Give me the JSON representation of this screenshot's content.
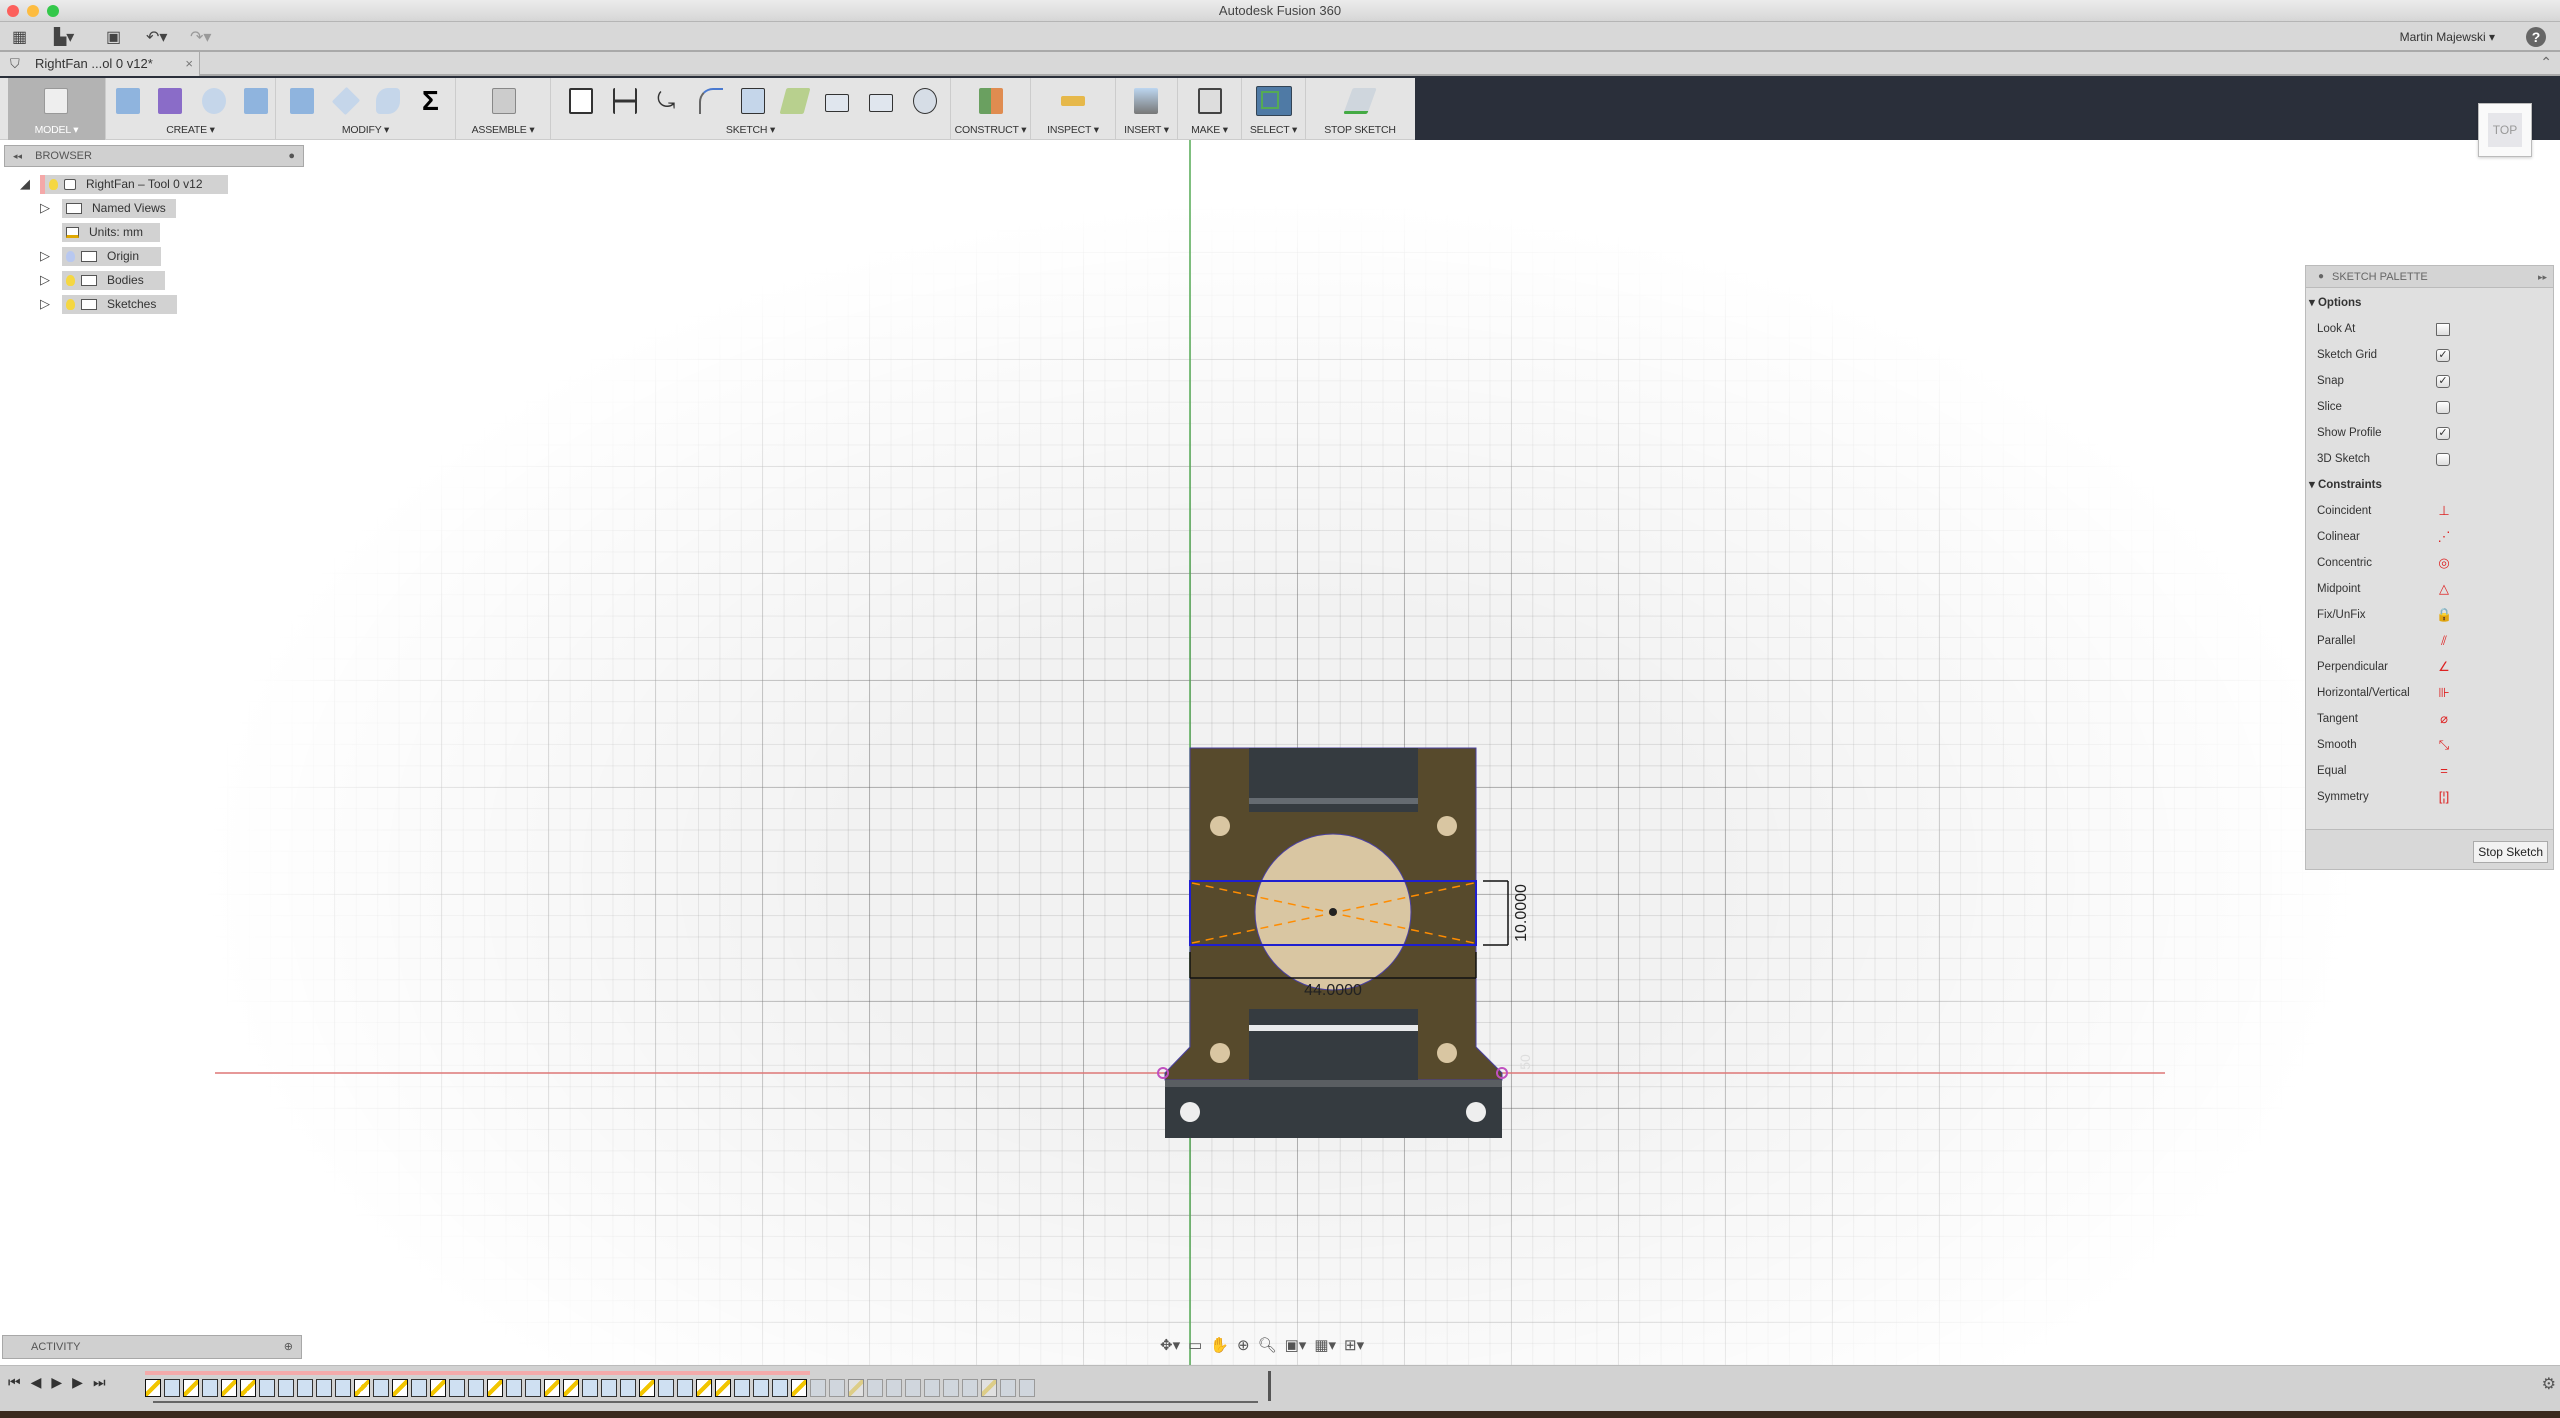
{
  "window": {
    "title": "Autodesk Fusion 360",
    "user": "Martin Majewski",
    "help_label": "?"
  },
  "quick_access": [
    {
      "name": "data-panel",
      "icon": "grid-icon"
    },
    {
      "name": "file",
      "icon": "file-icon"
    },
    {
      "name": "save",
      "icon": "save-icon"
    },
    {
      "name": "undo",
      "icon": "undo-icon"
    },
    {
      "name": "redo",
      "icon": "redo-icon"
    }
  ],
  "document_tab": {
    "label": "RightFan ...ol 0 v12*",
    "close": "×"
  },
  "ribbon": {
    "groups": [
      {
        "label": "MODEL ▾",
        "tools": [
          "model-workspace"
        ]
      },
      {
        "label": "CREATE ▾",
        "tools": [
          "box",
          "coil",
          "hole",
          "extrude"
        ]
      },
      {
        "label": "MODIFY ▾",
        "tools": [
          "press-pull",
          "fillet",
          "chamfer",
          "parameters"
        ]
      },
      {
        "label": "ASSEMBLE ▾",
        "tools": [
          "joint"
        ]
      },
      {
        "label": "SKETCH ▾",
        "tools": [
          "create-sketch",
          "dimension",
          "trim",
          "fillet-sketch",
          "offset",
          "project",
          "rectangle",
          "center-rectangle",
          "polygon"
        ]
      },
      {
        "label": "CONSTRUCT ▾",
        "tools": [
          "offset-plane"
        ]
      },
      {
        "label": "INSPECT ▾",
        "tools": [
          "measure"
        ]
      },
      {
        "label": "INSERT ▾",
        "tools": [
          "canvas"
        ]
      },
      {
        "label": "MAKE ▾",
        "tools": [
          "3d-print"
        ]
      },
      {
        "label": "SELECT ▾",
        "tools": [
          "select"
        ]
      },
      {
        "label": "STOP SKETCH",
        "tools": [
          "stop-sketch"
        ]
      }
    ]
  },
  "browser": {
    "title": "BROWSER",
    "items": [
      {
        "label": "RightFan – Tool 0 v12",
        "bulb": "on"
      },
      {
        "label": "Named Views"
      },
      {
        "label": "Units: mm"
      },
      {
        "label": "Origin",
        "bulb": "off"
      },
      {
        "label": "Bodies",
        "bulb": "on"
      },
      {
        "label": "Sketches",
        "bulb": "on"
      }
    ]
  },
  "activity": {
    "title": "ACTIVITY"
  },
  "viewcube": {
    "face": "TOP"
  },
  "sketch": {
    "dim_width": "44.0000",
    "dim_height": "10.0000",
    "grid_label": "50"
  },
  "sketch_palette": {
    "title": "SKETCH PALETTE",
    "options_label": "Options",
    "options": [
      {
        "label": "Look At",
        "type": "button"
      },
      {
        "label": "Sketch Grid",
        "checked": true
      },
      {
        "label": "Snap",
        "checked": true
      },
      {
        "label": "Slice",
        "checked": false
      },
      {
        "label": "Show Profile",
        "checked": true
      },
      {
        "label": "3D Sketch",
        "checked": false
      }
    ],
    "constraints_label": "Constraints",
    "constraints": [
      {
        "label": "Coincident",
        "glyph": "⊥"
      },
      {
        "label": "Colinear",
        "glyph": "⋰"
      },
      {
        "label": "Concentric",
        "glyph": "◎"
      },
      {
        "label": "Midpoint",
        "glyph": "△"
      },
      {
        "label": "Fix/UnFix",
        "glyph": "🔒"
      },
      {
        "label": "Parallel",
        "glyph": "⫽"
      },
      {
        "label": "Perpendicular",
        "glyph": "∠"
      },
      {
        "label": "Horizontal/Vertical",
        "glyph": "⊪"
      },
      {
        "label": "Tangent",
        "glyph": "⌀"
      },
      {
        "label": "Smooth",
        "glyph": "⤡"
      },
      {
        "label": "Equal",
        "glyph": "="
      },
      {
        "label": "Symmetry",
        "glyph": "[¦]"
      }
    ],
    "stop_label": "Stop Sketch"
  },
  "colors": {
    "plate": "#574a2c",
    "profile": "#d9c6a2",
    "slot": "#353b40",
    "selection": "#1f1fd0",
    "construction": "#ff8c00",
    "x_axis": "#c84848",
    "y_axis": "#3a9a3a"
  },
  "timeline": {
    "active": [
      "sketch",
      "extrude",
      "sketch",
      "extrude",
      "sketch",
      "sketch",
      "extrude",
      "extrude",
      "fillet",
      "fillet",
      "chamfer",
      "sketch",
      "hole",
      "sketch",
      "extrude",
      "sketch",
      "extrude",
      "fillet",
      "sketch",
      "extrude",
      "fillet",
      "sketch",
      "sketch",
      "extrude",
      "hole",
      "fillet",
      "sketch",
      "extrude",
      "fillet",
      "sketch",
      "sketch",
      "extrude",
      "fillet",
      "hole",
      "sketch"
    ],
    "inactive": [
      "extrude",
      "fillet",
      "sketch",
      "extrude",
      "extrude",
      "extrude",
      "fillet",
      "fillet",
      "plane",
      "sketch",
      "extrude",
      "fillet"
    ]
  }
}
